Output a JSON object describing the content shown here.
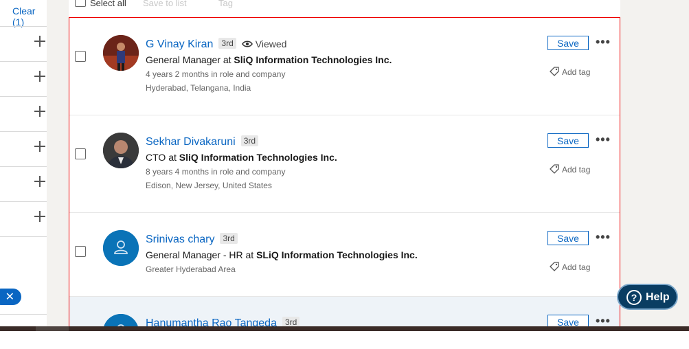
{
  "filters": {
    "clear_label": "Clear (1)"
  },
  "toolbar": {
    "select_all": "Select all",
    "save_to_list": "Save to list",
    "tag": "Tag"
  },
  "results": [
    {
      "name": "G Vinay Kiran",
      "degree": "3rd",
      "viewed": "Viewed",
      "role": "General Manager",
      "at": "at",
      "company": "SliQ Information Technologies Inc.",
      "tenure": "4 years 2 months in role and company",
      "location": "Hyderabad, Telangana, India",
      "save": "Save",
      "add_tag": "Add tag"
    },
    {
      "name": "Sekhar Divakaruni",
      "degree": "3rd",
      "role": "CTO",
      "at": "at",
      "company": "SliQ Information Technologies Inc.",
      "tenure": "8 years 4 months in role and company",
      "location": "Edison, New Jersey, United States",
      "save": "Save",
      "add_tag": "Add tag"
    },
    {
      "name": "Srinivas chary",
      "degree": "3rd",
      "role": "General Manager - HR",
      "at": "at",
      "company": "SLiQ Information Technologies Inc.",
      "location": "Greater Hyderabad Area",
      "save": "Save",
      "add_tag": "Add tag"
    },
    {
      "name": "Hanumantha Rao Tangeda",
      "degree": "3rd",
      "save": "Save"
    }
  ],
  "help": {
    "label": "Help"
  },
  "colors": {
    "link": "#0a66c2",
    "highlight_border": "#e00000",
    "help_bg": "#0a3d62"
  }
}
